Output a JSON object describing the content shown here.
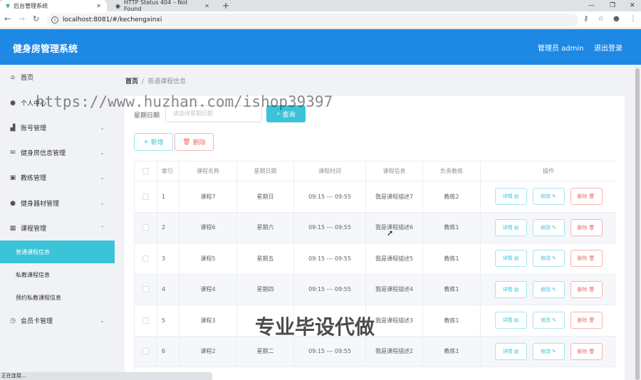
{
  "browser": {
    "tabs": [
      {
        "title": "后台管理系统",
        "icon": "vue-logo-icon"
      },
      {
        "title": "HTTP Status 404 – Not Found",
        "icon": "globe-icon"
      }
    ],
    "url": "localhost:8081/#/kechengxinxi"
  },
  "header": {
    "brand": "健身房管理系统",
    "user": "管理员 admin",
    "logout": "退出登录",
    "color": "#1e88e5"
  },
  "sidebar": {
    "items": [
      {
        "label": "首页",
        "icon": "home-icon"
      },
      {
        "label": "个人中心",
        "icon": "person-icon"
      },
      {
        "label": "账号管理",
        "icon": "chart-icon"
      },
      {
        "label": "健身房信息管理",
        "icon": "mail-icon"
      },
      {
        "label": "教练管理",
        "icon": "briefcase-icon"
      },
      {
        "label": "健身器材管理",
        "icon": "person-icon"
      },
      {
        "label": "课程管理",
        "icon": "calendar-icon"
      },
      {
        "label": "会员卡管理",
        "icon": "clock-icon"
      }
    ],
    "sub_items": [
      "普通课程信息",
      "私教课程信息",
      "预约私教课程信息"
    ],
    "active_color": "#3bc3d8"
  },
  "breadcrumb": {
    "home": "首页",
    "sep": "/",
    "current": "普通课程信息"
  },
  "search": {
    "label": "星期日期",
    "placeholder": "请选择星期日期",
    "button": "查询"
  },
  "actions": {
    "add": "新增",
    "delete": "删除"
  },
  "table": {
    "headers": [
      "索引",
      "课程名称",
      "星期日期",
      "课程时间",
      "课程信息",
      "负责教练",
      "操作"
    ],
    "rows": [
      [
        "1",
        "课程7",
        "星期日",
        "09:15 --- 09:55",
        "我是课程描述7",
        "教练2"
      ],
      [
        "2",
        "课程6",
        "星期六",
        "09:15 --- 09:55",
        "我是课程描述6",
        "教练1"
      ],
      [
        "3",
        "课程5",
        "星期五",
        "09:15 --- 09:55",
        "我是课程描述5",
        "教练1"
      ],
      [
        "4",
        "课程4",
        "星期四",
        "09:15 --- 09:55",
        "我是课程描述4",
        "教练1"
      ],
      [
        "5",
        "课程3",
        "",
        "",
        "我是课程描述3",
        "教练1"
      ],
      [
        "6",
        "课程2",
        "星期二",
        "09:15 --- 09:55",
        "我是课程描述2",
        "教练1"
      ]
    ],
    "ops": {
      "detail": "详情",
      "edit": "修改",
      "remove": "删除"
    }
  },
  "status": "正在连接...",
  "watermarks": [
    "https://www.huzhan.com/ishop39397",
    "专业毕设代做"
  ]
}
